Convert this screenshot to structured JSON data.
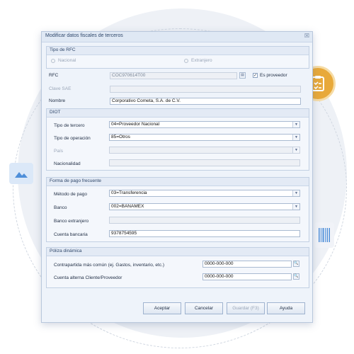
{
  "dialog": {
    "title": "Modificar datos fiscales de terceros",
    "close_glyph": "☒"
  },
  "tipo_rfc": {
    "group_label": "Tipo de RFC",
    "nacional_label": "Nacional",
    "extranjero_label": "Extranjero"
  },
  "rfc": {
    "label": "RFC",
    "value": "COC970614T00",
    "es_proveedor_label": "Es proveedor",
    "es_proveedor_checked": true
  },
  "clave_sae": {
    "label": "Clave SAE",
    "value": ""
  },
  "nombre": {
    "label": "Nombre",
    "value": "Corporativo Cometa, S.A. de C.V."
  },
  "diot": {
    "group_label": "DIOT",
    "tipo_tercero_label": "Tipo de tercero",
    "tipo_tercero_value": "04=Proveedor Nacional",
    "tipo_operacion_label": "Tipo de operación",
    "tipo_operacion_value": "85=Otros",
    "pais_label": "País",
    "pais_value": "",
    "nacionalidad_label": "Nacionalidad",
    "nacionalidad_value": ""
  },
  "forma_pago": {
    "group_label": "Forma de pago frecuente",
    "metodo_label": "Método de pago",
    "metodo_value": "03=Transferencia",
    "banco_label": "Banco",
    "banco_value": "002=BANAMEX",
    "banco_ext_label": "Banco extranjero",
    "banco_ext_value": "",
    "cuenta_label": "Cuenta bancaria",
    "cuenta_value": "9378754595"
  },
  "poliza": {
    "group_label": "Póliza dinámica",
    "contrapartida_label": "Contrapartida más común (ej. Gastos, inventario, etc.)",
    "contrapartida_value": "0000-000-000",
    "cuenta_alterna_label": "Cuenta alterna Cliente/Proveedor",
    "cuenta_alterna_value": "0000-000-000"
  },
  "buttons": {
    "aceptar": "Aceptar",
    "cancelar": "Cancelar",
    "guardar": "Guardar (F3)",
    "ayuda": "Ayuda"
  },
  "colors": {
    "accent": "#e8a93a",
    "window_bg": "#eef3fa",
    "border": "#b8c7dc"
  },
  "icons": {
    "decor_left": "image-icon",
    "decor_right_top": "clipboard-check-icon",
    "decor_right_bottom": "barcode-icon"
  }
}
